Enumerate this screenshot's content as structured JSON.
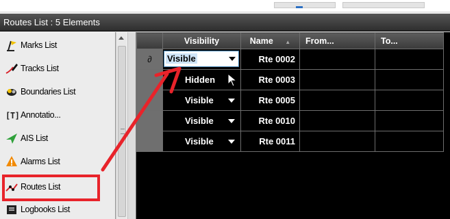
{
  "window": {
    "title": "Routes List : 5 Elements"
  },
  "sidebar": {
    "items": [
      {
        "label": "Marks List",
        "icon": "flag-icon"
      },
      {
        "label": "Tracks List",
        "icon": "pen-track-icon"
      },
      {
        "label": "Boundaries List",
        "icon": "cloud-boundary-icon"
      },
      {
        "label": "Annotatio...",
        "icon": "text-annotation-icon"
      },
      {
        "label": "AIS List",
        "icon": "ais-arrow-icon"
      },
      {
        "label": "Alarms List",
        "icon": "warning-icon"
      },
      {
        "label": "Routes List",
        "icon": "route-icon"
      },
      {
        "label": "Logbooks List",
        "icon": "logbook-icon"
      }
    ],
    "selected": "Routes List"
  },
  "grid": {
    "columns": [
      "Visibility",
      "Name",
      "From...",
      "To..."
    ],
    "sort_indicator": "▲",
    "row_edit_glyph": "∂",
    "rows": [
      {
        "visibility": "Visible",
        "name": "Rte 0002",
        "editing": true
      },
      {
        "visibility": "Hidden",
        "name": "Rte 0003",
        "editing": false
      },
      {
        "visibility": "Visible",
        "name": "Rte 0005",
        "editing": false
      },
      {
        "visibility": "Visible",
        "name": "Rte 0010",
        "editing": false
      },
      {
        "visibility": "Visible",
        "name": "Rte 0011",
        "editing": false
      }
    ]
  },
  "colors": {
    "highlight": "#e8232a",
    "grid_bg": "#000000",
    "title_bg": "#3a3a3a"
  }
}
